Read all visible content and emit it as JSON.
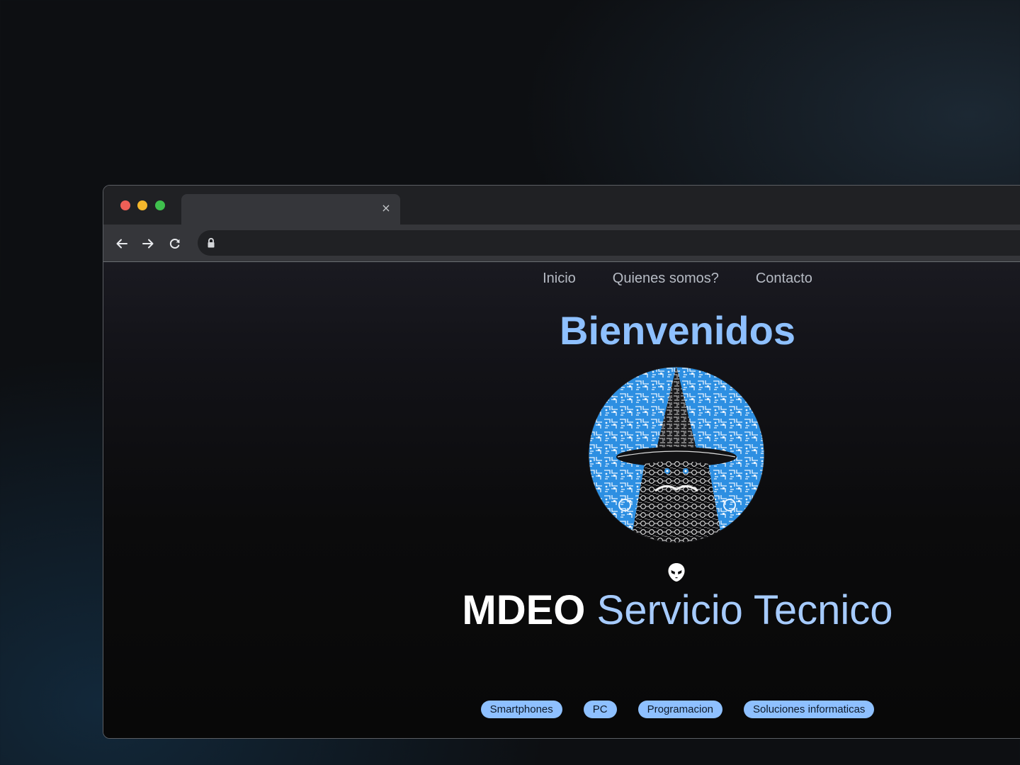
{
  "browser": {
    "tab": {
      "title": "",
      "close_glyph": "×",
      "close_icon": "close-icon"
    },
    "traffic_lights": {
      "red": "#ee5f57",
      "yellow": "#f4b72c",
      "green": "#3fc04d"
    },
    "toolbar": {
      "back_icon": "arrow-left-icon",
      "forward_icon": "arrow-right-icon",
      "reload_icon": "reload-icon",
      "address": "",
      "lock_icon": "lock-icon"
    }
  },
  "site": {
    "nav": [
      {
        "label": "Inicio"
      },
      {
        "label": "Quienes somos?"
      },
      {
        "label": "Contacto"
      }
    ],
    "heading": "Bienvenidos",
    "logo_icon": "wizard-logo",
    "brand_icon": "alien-icon",
    "brand": {
      "strong": "MDEO",
      "light": "Servicio Tecnico"
    },
    "tags": [
      {
        "label": "Smartphones"
      },
      {
        "label": "PC"
      },
      {
        "label": "Programacion"
      },
      {
        "label": "Soluciones informaticas"
      }
    ],
    "colors": {
      "accent": "#8ec0ff",
      "brand_light": "#a6cbff"
    }
  }
}
